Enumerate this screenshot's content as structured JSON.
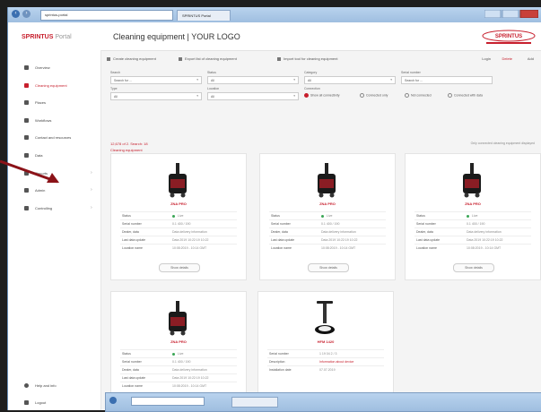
{
  "browser": {
    "address_text": "sprintus-portal",
    "tab_label": "SPRINTUS Portal"
  },
  "header": {
    "brand": "SPRINTUS",
    "brand_suffix": "Portal",
    "page_title": "Cleaning equipment  |  YOUR LOGO",
    "logo_text": "SPRINTUS"
  },
  "sidebar": {
    "items": [
      {
        "label": "Overview"
      },
      {
        "label": "Cleaning equipment"
      },
      {
        "label": "Places"
      },
      {
        "label": "Workflows"
      },
      {
        "label": "Contact and resources"
      },
      {
        "label": "Data"
      },
      {
        "label": "Reports"
      },
      {
        "label": "Admin"
      },
      {
        "label": "Controlling"
      }
    ],
    "bottom_items": [
      {
        "label": "Help and info"
      },
      {
        "label": "Logout"
      }
    ]
  },
  "toolbar": {
    "btn1": "Create cleaning equipment",
    "btn2": "Export list of cleaning equipment",
    "btn3": "Import tool for cleaning equipment",
    "right1": "Login",
    "right2": "Delete",
    "right3": "Add"
  },
  "filters": {
    "labels": [
      "Search",
      "Status",
      "Category",
      "Serial number",
      "Type",
      "Location",
      "Connection"
    ],
    "values": [
      "Search for ...",
      "All",
      "All",
      "Search for ...",
      "All",
      "All"
    ],
    "radios": [
      "Show all connectivity",
      "Connected only",
      "Not connected",
      "Connected with data"
    ]
  },
  "results": {
    "count": "12,678 of 2. Search: 18",
    "sub": "Cleaning equipment",
    "note": "Only connected cleaning equipment displayed"
  },
  "cards": [
    {
      "model": "ZNA PRO",
      "show": "Show details"
    },
    {
      "model": "ZNA PRO",
      "show": "Show details"
    },
    {
      "model": "ZNA PRO",
      "show": "Show details"
    },
    {
      "model": "ZNA PRO",
      "show": "Show details"
    },
    {
      "model": "HFM 1420",
      "show": ""
    }
  ],
  "card_rows": {
    "k1": "Status",
    "k2": "Serial number",
    "k3": "Dealer, data",
    "k4": "Last data update",
    "k5": "Location name",
    "v1": "Live",
    "v2": "0.1 400 / 190",
    "v3": "Data delivery information",
    "v4": "Data 2019 10:22:19 10:22",
    "v5": "10:08:2019 - 10:14 GMT"
  },
  "card5_rows": {
    "k1": "Serial number",
    "k2": "Description",
    "k3": "Installation date",
    "v1": "1 19 04 2 / 3",
    "v2": "Information about device",
    "v3": "07.07.2019"
  },
  "colors": {
    "accent": "#c71f2d",
    "status_live": "#3aa655"
  }
}
